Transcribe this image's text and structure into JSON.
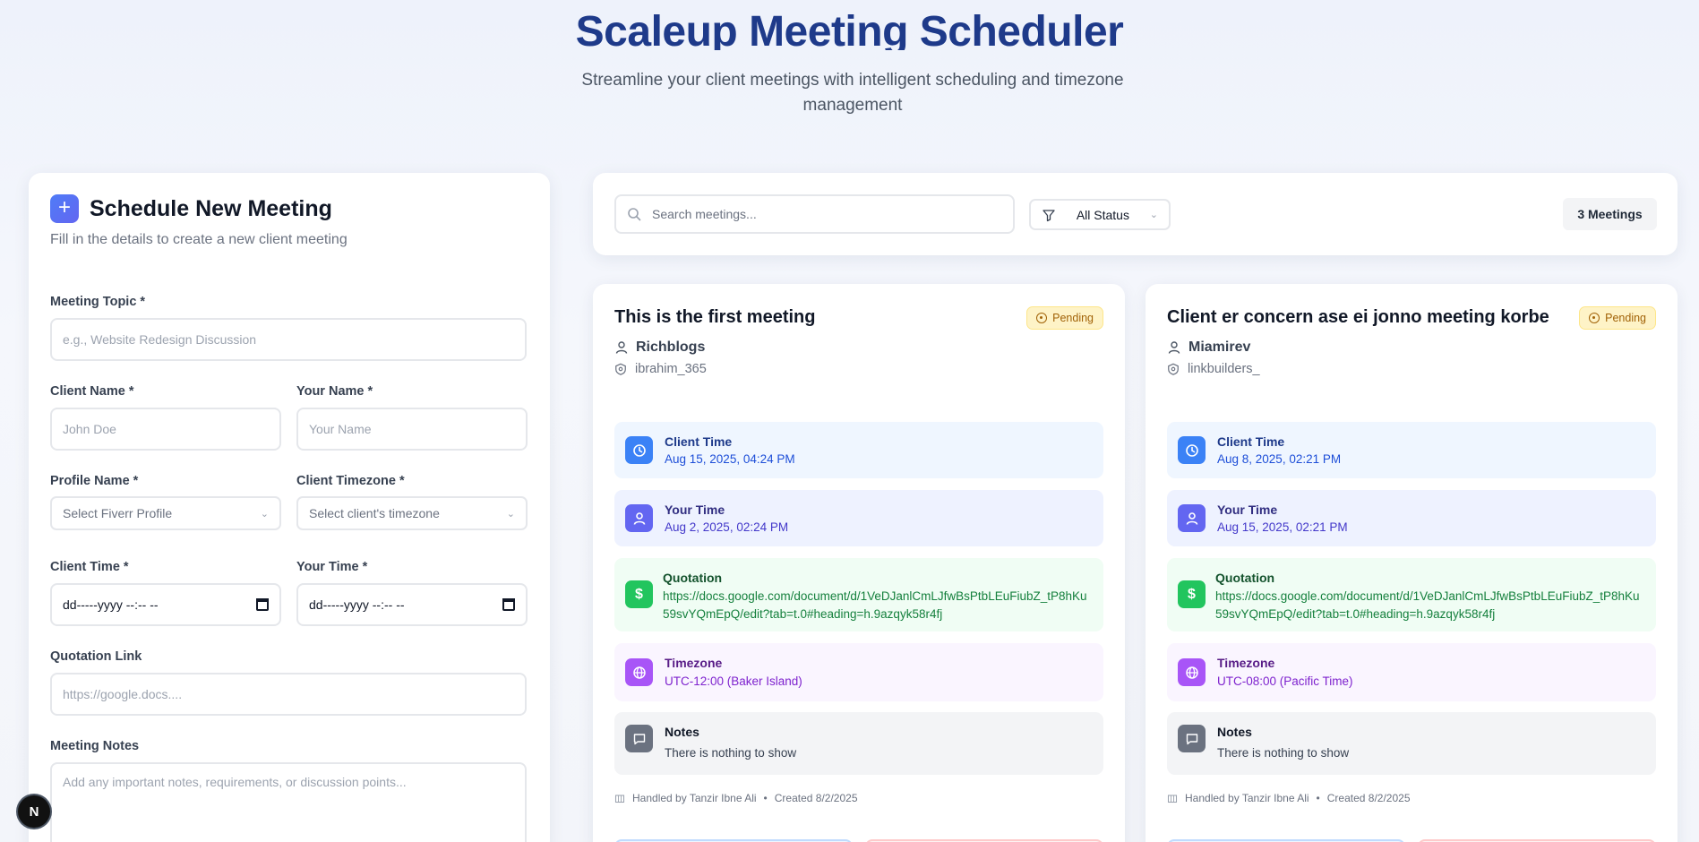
{
  "header": {
    "title": "Scaleup Meeting Scheduler",
    "subtitle": "Streamline your client meetings with intelligent scheduling and timezone management"
  },
  "form": {
    "title": "Schedule New Meeting",
    "subtitle": "Fill in the details to create a new client meeting",
    "topic_label": "Meeting Topic *",
    "topic_placeholder": "e.g., Website Redesign Discussion",
    "client_name_label": "Client Name *",
    "client_name_placeholder": "John Doe",
    "your_name_label": "Your Name *",
    "your_name_placeholder": "Your Name",
    "profile_label": "Profile Name *",
    "profile_placeholder": "Select Fiverr Profile",
    "client_tz_label": "Client Timezone *",
    "client_tz_placeholder": "Select client's timezone",
    "client_time_label": "Client Time *",
    "client_time_value": "dd-----yyyy --:-- --",
    "your_time_label": "Your Time *",
    "your_time_value": "dd-----yyyy --:-- --",
    "quote_label": "Quotation Link",
    "quote_placeholder": "https://google.docs....",
    "notes_label": "Meeting Notes",
    "notes_placeholder": "Add any important notes, requirements, or discussion points..."
  },
  "toolbar": {
    "search_placeholder": "Search meetings...",
    "status_filter": "All Status",
    "count": "3 Meetings"
  },
  "labels": {
    "client_time": "Client Time",
    "your_time": "Your Time",
    "quotation": "Quotation",
    "timezone": "Timezone",
    "notes": "Notes"
  },
  "meetings": [
    {
      "title": "This is the first meeting",
      "status": "Pending",
      "client": "Richblogs",
      "profile": "ibrahim_365",
      "client_time": "Aug 15, 2025, 04:24 PM",
      "your_time": "Aug 2, 2025, 02:24 PM",
      "quotation": "https://docs.google.com/document/d/1VeDJanlCmLJfwBsPtbLEuFiubZ_tP8hKu59svYQmEpQ/edit?tab=t.0#heading=h.9azqyk58r4fj",
      "timezone": "UTC-12:00 (Baker Island)",
      "notes": "There is nothing to show",
      "handled_by": "Handled by Tanzir Ibne Ali",
      "created": "Created 8/2/2025"
    },
    {
      "title": "Client er concern ase ei jonno meeting korbe",
      "status": "Pending",
      "client": "Miamirev",
      "profile": "linkbuilders_",
      "client_time": "Aug 8, 2025, 02:21 PM",
      "your_time": "Aug 15, 2025, 02:21 PM",
      "quotation": "https://docs.google.com/document/d/1VeDJanlCmLJfwBsPtbLEuFiubZ_tP8hKu59svYQmEpQ/edit?tab=t.0#heading=h.9azqyk58r4fj",
      "timezone": "UTC-08:00 (Pacific Time)",
      "notes": "There is nothing to show",
      "handled_by": "Handled by Tanzir Ibne Ali",
      "created": "Created 8/2/2025"
    }
  ],
  "next_badge": "N"
}
